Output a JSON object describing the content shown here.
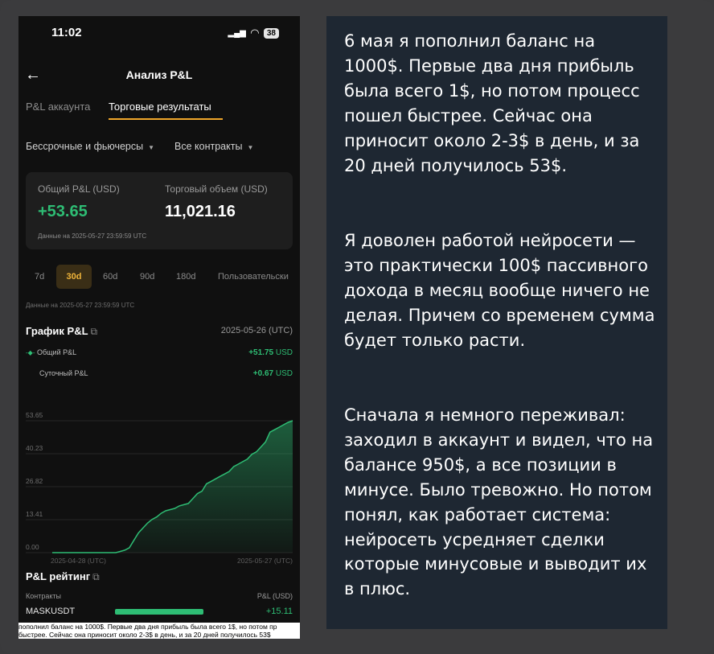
{
  "status_bar": {
    "time": "11:02",
    "signal": "▂▄▆",
    "wifi": "◠",
    "battery": "38"
  },
  "header": {
    "title": "Анализ P&L",
    "back": "←"
  },
  "tabs": [
    {
      "label": "P&L аккаунта",
      "active": false
    },
    {
      "label": "Торговые результаты",
      "active": true
    }
  ],
  "filters": {
    "market": "Бессрочные и фьючерсы",
    "contracts": "Все контракты",
    "caret": "▼"
  },
  "summary": {
    "total_pnl_label": "Общий P&L (USD)",
    "total_pnl_value": "+53.65",
    "volume_label": "Торговый объем (USD)",
    "volume_value": "11,021.16",
    "note": "Данные на 2025-05-27 23:59:59 UTC"
  },
  "periods": [
    "7d",
    "30d",
    "60d",
    "90d",
    "180d",
    "Пользовательски"
  ],
  "active_period": "30d",
  "periods_note": "Данные на 2025-05-27 23:59:59 UTC",
  "chart_header": {
    "title": "График P&L",
    "ext_icon": "⧉",
    "date": "2025-05-26 (UTC)",
    "legend": [
      {
        "label": "Общий P&L",
        "value": "+51.75",
        "unit": "USD"
      },
      {
        "label": "Суточный P&L",
        "value": "+0.67",
        "unit": "USD"
      }
    ]
  },
  "chart_data": {
    "type": "area",
    "y_ticks": [
      "53.65",
      "40.23",
      "26.82",
      "13.41",
      "0.00"
    ],
    "x_ticks": [
      "2025-04-28 (UTC)",
      "2025-05-27 (UTC)"
    ],
    "ylim": [
      0,
      53.65
    ],
    "color": "#2ebd74",
    "values": [
      0,
      0,
      0,
      0,
      0,
      0,
      0,
      0,
      0,
      0,
      0,
      0,
      0,
      0,
      0,
      0.5,
      1,
      2,
      5,
      8,
      10,
      12,
      13.5,
      14.5,
      16,
      17,
      17.5,
      18,
      19,
      19.5,
      20,
      22,
      24,
      25,
      28,
      29,
      30,
      31,
      32,
      33,
      35,
      36,
      37,
      38,
      40,
      41,
      43,
      45,
      49,
      50,
      51,
      52,
      53,
      53.65
    ]
  },
  "rating": {
    "title": "P&L рейтинг",
    "ext_icon": "⧉",
    "col_contracts": "Контракты",
    "col_pnl": "P&L (USD)",
    "rows": [
      {
        "symbol": "MASKUSDT",
        "value": "+15.11",
        "share": 0.73
      }
    ]
  },
  "caption": {
    "line1": "пополнил баланс на 1000$. Первые два дня прибыль была всего 1$, но потом пр",
    "line2": "быстрее. Сейчас она приносит около 2-3$ в день, и за 20 дней получилось 53$"
  },
  "text_panel": {
    "paragraphs": [
      "6 мая я пополнил баланс на 1000$. Первые два дня прибыль была всего 1$, но потом процесс пошел быстрее. Сейчас она приносит около 2-3$ в день, и за 20 дней получилось 53$.",
      "Я доволен работой нейросети — это практически 100$ пассивного дохода в месяц вообще ничего не делая. Причем со временем сумма будет только расти.",
      "Сначала я немного переживал: заходил в аккаунт и видел, что на балансе 950$, а все позиции в минусе. Было тревожно. Но потом понял, как работает система: нейросеть  усредняет сделки которые минусовые и выводит их в плюс."
    ]
  }
}
